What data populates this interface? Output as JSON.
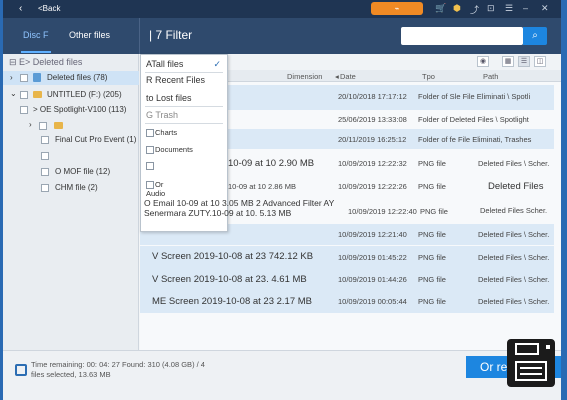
{
  "titlebar": {
    "back_arrow": "‹",
    "back_label": "<Back",
    "upgrade_label": "⌁"
  },
  "navbar": {
    "tab_disc": "Disc F",
    "tab_other": "Other files",
    "filter_title": "| 7 Filter",
    "search_icon": "⌕"
  },
  "sidebar": {
    "deleted_files_header": "⊟ E> Deleted files",
    "items": [
      {
        "label": "Deleted files (78)"
      },
      {
        "label": "UNTITLED (F:) (205)"
      },
      {
        "label": "> OE Spotlight-V100 (113)"
      },
      {
        "label": "Final Cut Pro Event (1)"
      },
      {
        "label": "O MOF file (12)"
      },
      {
        "label": "CHM file (2)"
      }
    ]
  },
  "dropdown": {
    "items": [
      "ATall files",
      "R Recent Files",
      "to Lost files",
      "G Trash",
      "Charts",
      "Documents",
      "Or",
      "Audio"
    ],
    "check": "✓"
  },
  "columns": {
    "dimension": "Dimension",
    "date": "Date",
    "type": "Tpo",
    "path": "Path"
  },
  "rows": [
    {
      "name": "",
      "size": "",
      "date": "20/10/2018 17:17:12",
      "type": "Folder of Sle File Eliminati \\ Spotli",
      "path": ""
    },
    {
      "name": "",
      "size": "",
      "date": "25/06/2019 13:33:08",
      "type": "Folder of Deleted Files \\ Spotlight",
      "path": ""
    },
    {
      "name": "",
      "size": "",
      "date": "20/11/2019 16:25:12",
      "type": "Folder of fe File Eliminati, Trashes",
      "path": ""
    },
    {
      "name": "10-09 at 10 2.90 MB",
      "size": "",
      "date": "10/09/2019 12:22:32",
      "type": "PNG file",
      "path": "Deleted Files \\ Scher."
    },
    {
      "name": "10-09 at 10 2.86 MB",
      "size": "",
      "date": "10/09/2019 12:22:26",
      "type": "PNG file",
      "path": "Deleted Files"
    },
    {
      "name": "",
      "size": "",
      "date": "10/09/2019 12:22:40",
      "type": "PNG file",
      "path": "Deleted Files Scher."
    },
    {
      "name": "",
      "size": "",
      "date": "10/09/2019 12:21:40",
      "type": "PNG file",
      "path": "Deleted Files \\ Scher."
    },
    {
      "name": "V Screen 2019-10-08 at 23 742.12 KB",
      "size": "",
      "date": "10/09/2019 01:45:22",
      "type": "PNG file",
      "path": "Deleted Files \\ Scher."
    },
    {
      "name": "V Screen 2019-10-08 at 23. 4.61 MB",
      "size": "",
      "date": "10/09/2019 01:44:26",
      "type": "PNG file",
      "path": "Deleted Files \\ Scher."
    },
    {
      "name": "ME Screen 2019-10-08 at 23 2.17 MB",
      "size": "",
      "date": "10/09/2019 00:05:44",
      "type": "PNG file",
      "path": "Deleted Files \\ Scher."
    }
  ],
  "overlay_text": "O Email 10-09 at 10 3.05 MB 2 Advanced Filter AY Senermara ZUTY.10-09 at 10. 5.13 MB",
  "footer": {
    "time_remaining": "Time remaining: 00: 04: 27 Found: 310 (4.08 GB) / 4",
    "selected": "files selected, 13.63 MB",
    "recover_label": "Or re"
  }
}
